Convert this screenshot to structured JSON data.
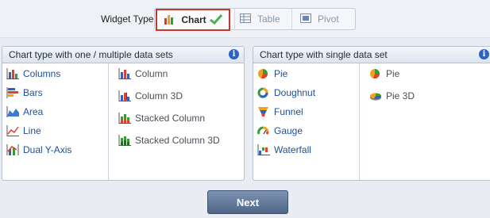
{
  "widget_type": {
    "label": "Widget Type",
    "options": [
      {
        "label": "Chart",
        "selected": true,
        "icon": "bar-chart-icon"
      },
      {
        "label": "Table",
        "selected": false,
        "icon": "table-icon"
      },
      {
        "label": "Pivot",
        "selected": false,
        "icon": "pivot-icon"
      }
    ]
  },
  "left_panel": {
    "title": "Chart type with one / multiple data sets",
    "col1": [
      {
        "label": "Columns",
        "icon": "columns-chart-icon"
      },
      {
        "label": "Bars",
        "icon": "bars-chart-icon"
      },
      {
        "label": "Area",
        "icon": "area-chart-icon"
      },
      {
        "label": "Line",
        "icon": "line-chart-icon"
      },
      {
        "label": "Dual Y-Axis",
        "icon": "dual-y-axis-chart-icon"
      }
    ],
    "col2": [
      {
        "label": "Column",
        "icon": "column-chart-icon"
      },
      {
        "label": "Column 3D",
        "icon": "column-3d-chart-icon"
      },
      {
        "label": "Stacked Column",
        "icon": "stacked-column-chart-icon"
      },
      {
        "label": "Stacked Column 3D",
        "icon": "stacked-column-3d-chart-icon"
      }
    ]
  },
  "right_panel": {
    "title": "Chart type with single data set",
    "col1": [
      {
        "label": "Pie",
        "icon": "pie-chart-icon"
      },
      {
        "label": "Doughnut",
        "icon": "doughnut-chart-icon"
      },
      {
        "label": "Funnel",
        "icon": "funnel-chart-icon"
      },
      {
        "label": "Gauge",
        "icon": "gauge-chart-icon"
      },
      {
        "label": "Waterfall",
        "icon": "waterfall-chart-icon"
      }
    ],
    "col2": [
      {
        "label": "Pie",
        "icon": "pie-chart-icon"
      },
      {
        "label": "Pie 3D",
        "icon": "pie-3d-chart-icon"
      }
    ]
  },
  "next_label": "Next",
  "colors": {
    "selected_border": "#c0392b",
    "link_blue": "#1f4e96",
    "button_blue": "#5f7696"
  }
}
